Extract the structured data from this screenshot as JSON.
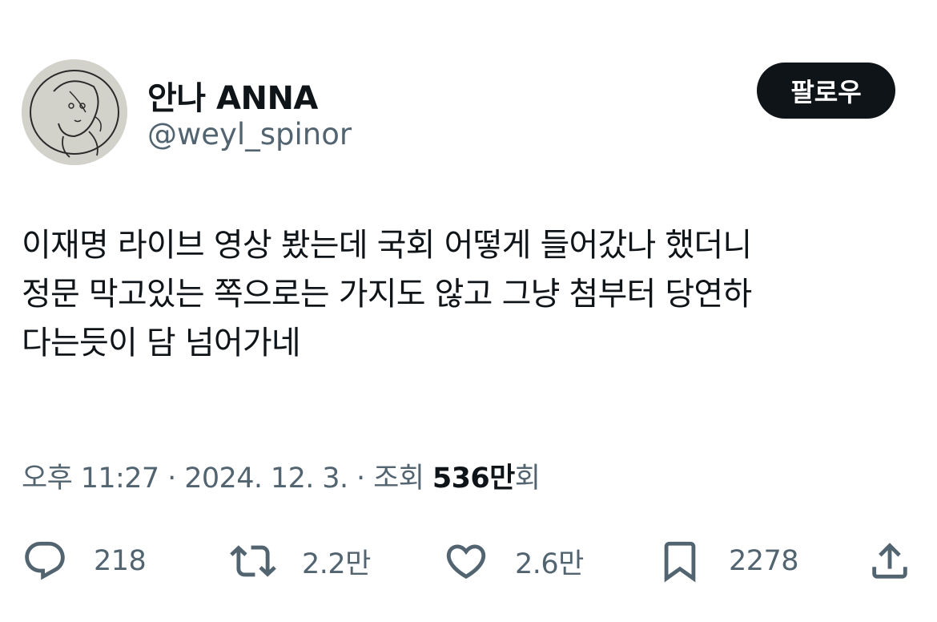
{
  "user": {
    "display_name": "안나 ANNA",
    "handle": "@weyl_spinor"
  },
  "follow_button": {
    "label": "팔로우"
  },
  "tweet": {
    "lines": [
      "이재명 라이브 영상 봤는데 국회 어떻게 들어갔나 했더니",
      "정문 막고있는 쪽으로는 가지도 않고 그냥 첨부터 당연하",
      "다는듯이 담 넘어가네"
    ]
  },
  "meta": {
    "time": "오후 11:27",
    "separator": "·",
    "date": "2024. 12. 3.",
    "views_label": "조회",
    "views_count": "536만",
    "views_suffix": "회"
  },
  "actions": {
    "reply": {
      "icon": "reply-icon",
      "count": "218"
    },
    "retweet": {
      "icon": "retweet-icon",
      "count": "2.2만"
    },
    "like": {
      "icon": "heart-icon",
      "count": "2.6만"
    },
    "bookmark": {
      "icon": "bookmark-icon",
      "count": "2278"
    },
    "share": {
      "icon": "share-icon"
    }
  },
  "colors": {
    "text_primary": "#0f1419",
    "text_secondary": "#536471",
    "button_bg": "#0f1419",
    "background": "#ffffff"
  }
}
